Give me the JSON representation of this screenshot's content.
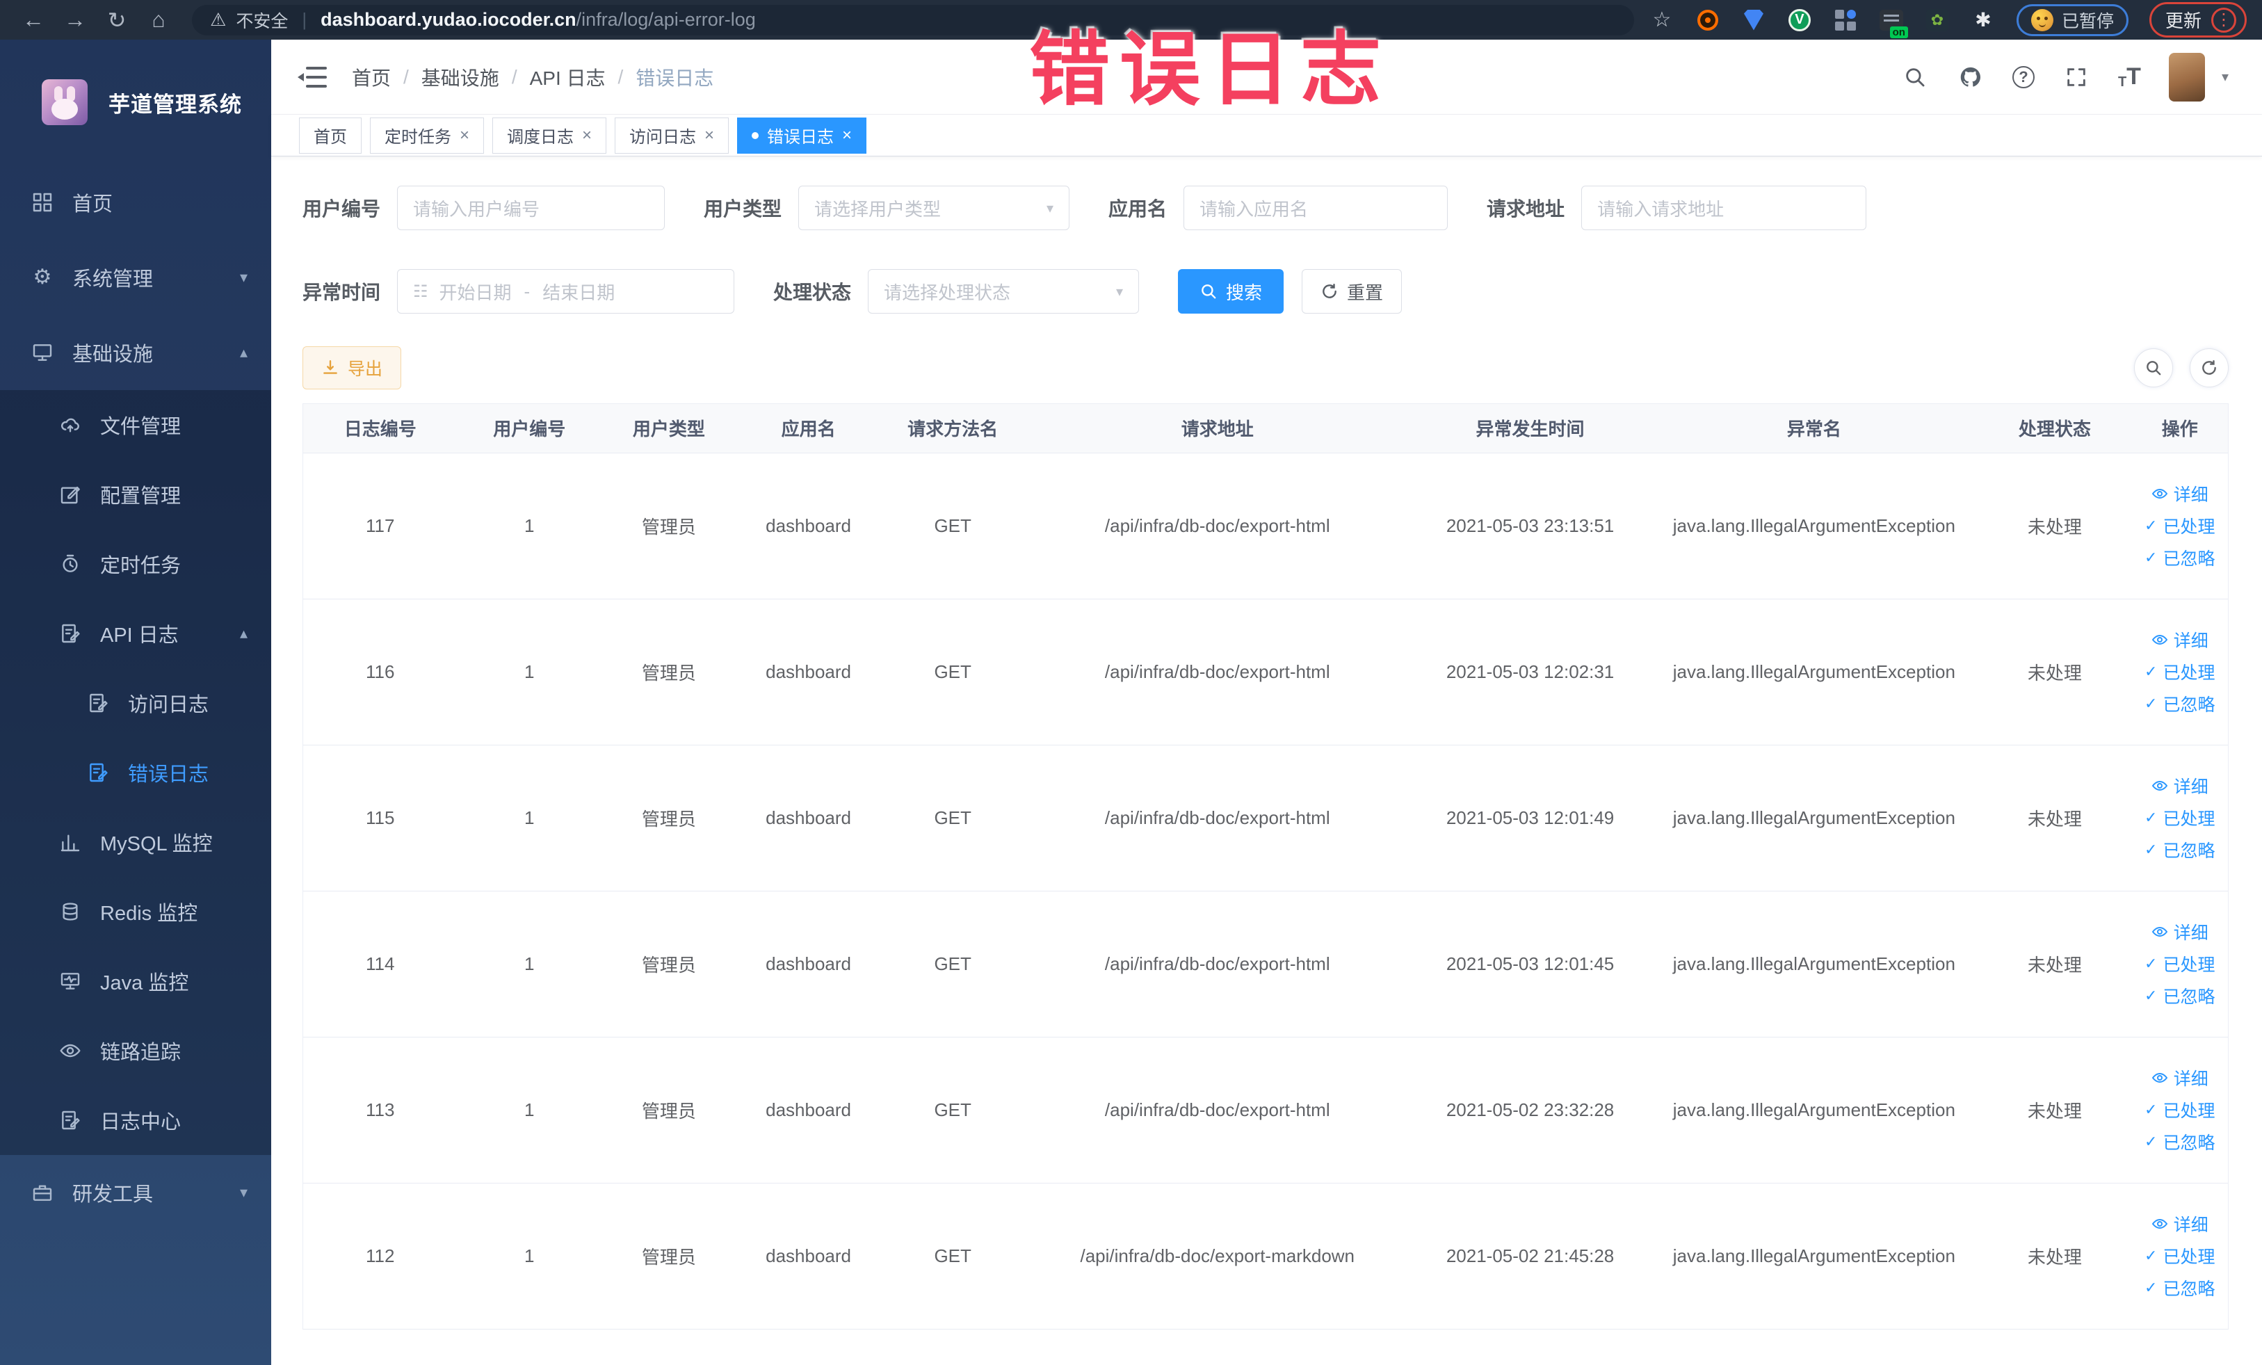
{
  "colors": {
    "primary": "#2a97ff",
    "warning": "#e6a23c",
    "annotation": "#f4405f",
    "sidebar_top": "#21355a",
    "sidebar_bottom": "#2e4b73",
    "chrome": "#232e3d"
  },
  "annotation": {
    "text": "错误日志"
  },
  "browser": {
    "security_label": "不安全",
    "url_divider": "|",
    "url_host": "dashboard.yudao.iocoder.cn",
    "url_path": "/infra/log/api-error-log",
    "ext_green_letter": "V",
    "ext_on_badge": "on",
    "paused_pill": "已暂停",
    "update_button": "更新"
  },
  "sidebar": {
    "title": "芋道管理系统",
    "items": {
      "home": "首页",
      "system": "系统管理",
      "infra": "基础设施",
      "file": "文件管理",
      "config": "配置管理",
      "job": "定时任务",
      "api_log": "API 日志",
      "access_log": "访问日志",
      "error_log": "错误日志",
      "mysql": "MySQL 监控",
      "redis": "Redis 监控",
      "java": "Java 监控",
      "trace": "链路追踪",
      "log_center": "日志中心",
      "dev_tools": "研发工具"
    }
  },
  "breadcrumb": {
    "sep": "/",
    "items": [
      "首页",
      "基础设施",
      "API 日志",
      "错误日志"
    ]
  },
  "tabs": [
    "首页",
    "定时任务",
    "调度日志",
    "访问日志",
    "错误日志"
  ],
  "filters": {
    "user_id_label": "用户编号",
    "user_id_placeholder": "请输入用户编号",
    "user_type_label": "用户类型",
    "user_type_placeholder": "请选择用户类型",
    "app_name_label": "应用名",
    "app_name_placeholder": "请输入应用名",
    "request_url_label": "请求地址",
    "request_url_placeholder": "请输入请求地址",
    "error_time_label": "异常时间",
    "start_date_placeholder": "开始日期",
    "range_separator": "-",
    "end_date_placeholder": "结束日期",
    "process_status_label": "处理状态",
    "process_status_placeholder": "请选择处理状态",
    "search_button": "搜索",
    "reset_button": "重置"
  },
  "toolbar": {
    "export_button": "导出"
  },
  "table": {
    "columns": [
      "日志编号",
      "用户编号",
      "用户类型",
      "应用名",
      "请求方法名",
      "请求地址",
      "异常发生时间",
      "异常名",
      "处理状态",
      "操作"
    ],
    "actions": [
      "详细",
      "已处理",
      "已忽略"
    ],
    "rows": [
      {
        "log_id": "117",
        "user_id": "1",
        "user_type": "管理员",
        "app_name": "dashboard",
        "method": "GET",
        "url": "/api/infra/db-doc/export-html",
        "time": "2021-05-03 23:13:51",
        "exception": "java.lang.IllegalArgumentException",
        "status": "未处理"
      },
      {
        "log_id": "116",
        "user_id": "1",
        "user_type": "管理员",
        "app_name": "dashboard",
        "method": "GET",
        "url": "/api/infra/db-doc/export-html",
        "time": "2021-05-03 12:02:31",
        "exception": "java.lang.IllegalArgumentException",
        "status": "未处理"
      },
      {
        "log_id": "115",
        "user_id": "1",
        "user_type": "管理员",
        "app_name": "dashboard",
        "method": "GET",
        "url": "/api/infra/db-doc/export-html",
        "time": "2021-05-03 12:01:49",
        "exception": "java.lang.IllegalArgumentException",
        "status": "未处理"
      },
      {
        "log_id": "114",
        "user_id": "1",
        "user_type": "管理员",
        "app_name": "dashboard",
        "method": "GET",
        "url": "/api/infra/db-doc/export-html",
        "time": "2021-05-03 12:01:45",
        "exception": "java.lang.IllegalArgumentException",
        "status": "未处理"
      },
      {
        "log_id": "113",
        "user_id": "1",
        "user_type": "管理员",
        "app_name": "dashboard",
        "method": "GET",
        "url": "/api/infra/db-doc/export-html",
        "time": "2021-05-02 23:32:28",
        "exception": "java.lang.IllegalArgumentException",
        "status": "未处理"
      },
      {
        "log_id": "112",
        "user_id": "1",
        "user_type": "管理员",
        "app_name": "dashboard",
        "method": "GET",
        "url": "/api/infra/db-doc/export-markdown",
        "time": "2021-05-02 21:45:28",
        "exception": "java.lang.IllegalArgumentException",
        "status": "未处理"
      }
    ]
  }
}
